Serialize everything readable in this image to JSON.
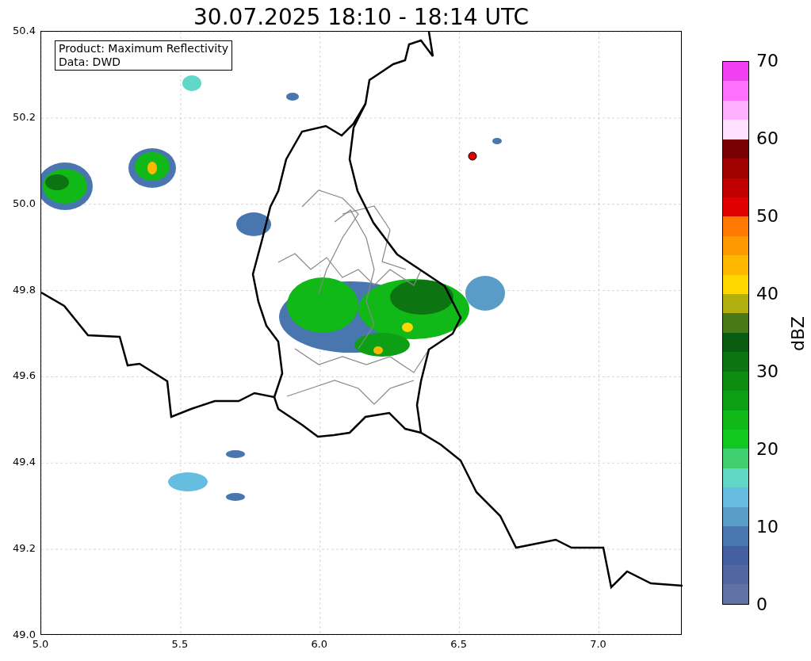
{
  "title": "30.07.2025 18:10 - 18:14 UTC",
  "info_box": {
    "lines": [
      "Product: Maximum Reflectivity",
      "Data: DWD"
    ]
  },
  "axes": {
    "xticks": [
      "5.0",
      "5.5",
      "6.0",
      "6.5",
      "7.0"
    ],
    "yticks": [
      "50.4",
      "50.2",
      "50.0",
      "49.8",
      "49.6",
      "49.4",
      "49.2",
      "49.0"
    ]
  },
  "colorbar": {
    "label": "dBZ",
    "ticks": [
      "70",
      "60",
      "50",
      "40",
      "30",
      "20",
      "10",
      "0"
    ],
    "bands": [
      {
        "color": "#f040f0"
      },
      {
        "color": "#ff70ff"
      },
      {
        "color": "#ffb0ff"
      },
      {
        "color": "#ffe0ff"
      },
      {
        "color": "#780000"
      },
      {
        "color": "#a00000"
      },
      {
        "color": "#c00000"
      },
      {
        "color": "#e00000"
      },
      {
        "color": "#ff7800"
      },
      {
        "color": "#ff9800"
      },
      {
        "color": "#ffb800"
      },
      {
        "color": "#ffd800"
      },
      {
        "color": "#b0b010"
      },
      {
        "color": "#487818"
      },
      {
        "color": "#0a5c10"
      },
      {
        "color": "#0c7410"
      },
      {
        "color": "#0c8c10"
      },
      {
        "color": "#0ea014"
      },
      {
        "color": "#10b818"
      },
      {
        "color": "#10c820"
      },
      {
        "color": "#40d070"
      },
      {
        "color": "#60d8c8"
      },
      {
        "color": "#66bde0"
      },
      {
        "color": "#5a9cc8"
      },
      {
        "color": "#4a76b0"
      },
      {
        "color": "#4560a0"
      },
      {
        "color": "#5466a0"
      },
      {
        "color": "#6272a4"
      }
    ]
  }
}
